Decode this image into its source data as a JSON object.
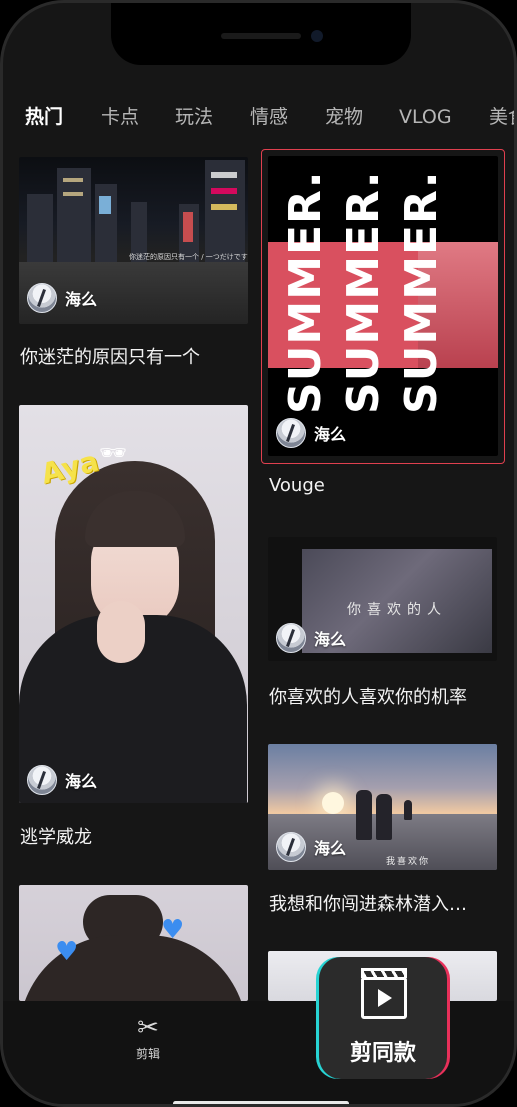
{
  "tabs": [
    "热门",
    "卡点",
    "玩法",
    "情感",
    "宠物",
    "VLOG",
    "美食"
  ],
  "active_tab": 0,
  "cards": [
    {
      "title": "你迷茫的原因只有一个",
      "author": "海么",
      "overlay_text": "你迷茫的原因只有一个 / 一つだけです"
    },
    {
      "title": "Vouge",
      "author": "海么",
      "overlay_text": "SUMMER."
    },
    {
      "title": "逃学威龙",
      "author": "海么",
      "overlay_text": "Aya"
    },
    {
      "title": "你喜欢的人喜欢你的机率",
      "author": "海么",
      "overlay_text": "你喜欢的人"
    },
    {
      "title": "我想和你闯进森林潜入…",
      "author": "海么",
      "overlay_text": "我喜欢你"
    },
    {
      "title": "",
      "author": "",
      "overlay_text": ""
    }
  ],
  "bottom_nav": {
    "edit_label": "剪辑",
    "same_style_label": "剪同款"
  },
  "colors": {
    "background": "#161616",
    "selected_border": "#e0404f",
    "accent_cyan": "#27d3d3",
    "accent_red": "#e8305a"
  }
}
